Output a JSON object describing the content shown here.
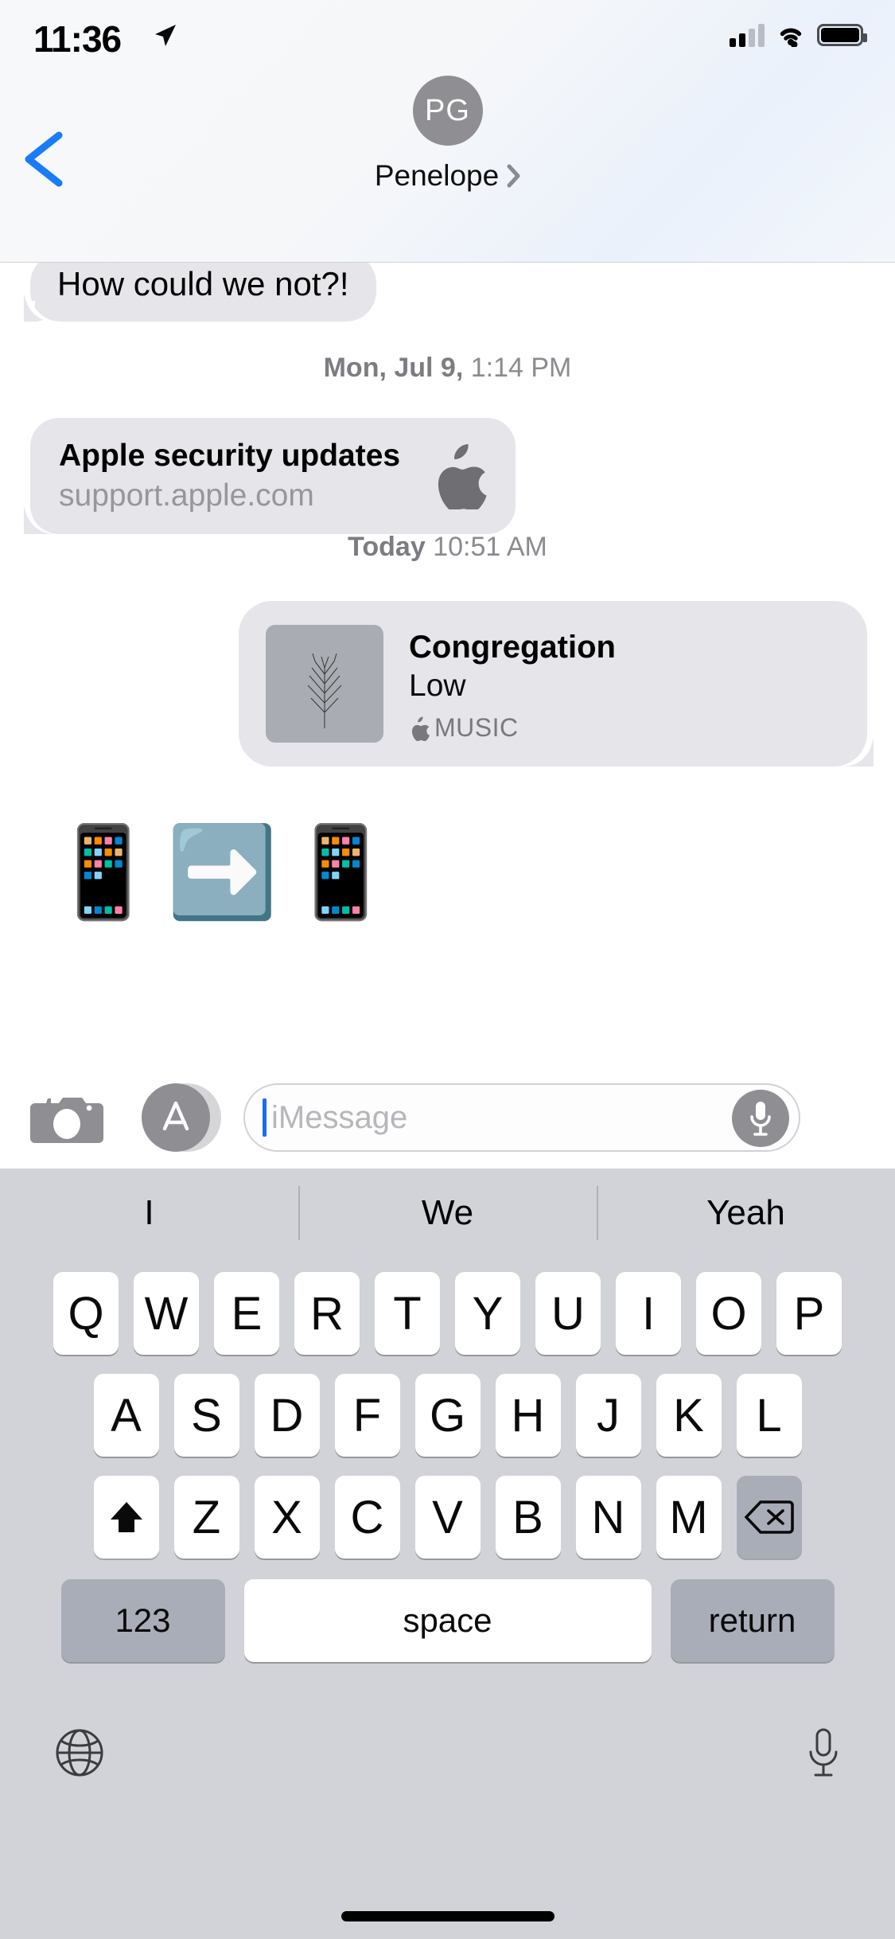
{
  "status_bar": {
    "time": "11:36",
    "location_icon": "location-arrow-icon",
    "cellular_icon": "cellular-bars-icon",
    "wifi_icon": "wifi-icon",
    "battery_icon": "battery-full-icon"
  },
  "header": {
    "back_icon": "chevron-left-icon",
    "avatar_initials": "PG",
    "contact_name": "Penelope",
    "detail_chevron_icon": "chevron-right-icon"
  },
  "conversation": [
    {
      "kind": "text",
      "side": "incoming",
      "text": "How could we not?!"
    },
    {
      "kind": "timestamp",
      "day": "Mon, Jul 9,",
      "time": "1:14 PM"
    },
    {
      "kind": "link-preview",
      "side": "incoming",
      "title": "Apple security updates",
      "domain": "support.apple.com",
      "icon": "apple-logo-icon"
    },
    {
      "kind": "timestamp",
      "day": "Today",
      "time": "10:51 AM"
    },
    {
      "kind": "music-card",
      "side": "outgoing",
      "title": "Congregation",
      "artist": "Low",
      "brand": "MUSIC",
      "brand_icon": "apple-logo-icon",
      "artwork": "bare-tree-album-art"
    },
    {
      "kind": "emoji",
      "side": "incoming",
      "text": "📱➡️📱"
    }
  ],
  "input_toolbar": {
    "camera_icon": "camera-icon",
    "appstore_icon": "app-store-icon",
    "message_placeholder": "iMessage",
    "message_value": "",
    "mic_icon": "microphone-icon"
  },
  "keyboard": {
    "predictions": [
      "I",
      "We",
      "Yeah"
    ],
    "row1": [
      "Q",
      "W",
      "E",
      "R",
      "T",
      "Y",
      "U",
      "I",
      "O",
      "P"
    ],
    "row2": [
      "A",
      "S",
      "D",
      "F",
      "G",
      "H",
      "J",
      "K",
      "L"
    ],
    "row3_letters": [
      "Z",
      "X",
      "C",
      "V",
      "B",
      "N",
      "M"
    ],
    "shift_icon": "shift-up-arrow-icon",
    "delete_icon": "backspace-delete-icon",
    "numeric_label": "123",
    "space_label": "space",
    "return_label": "return",
    "globe_icon": "globe-language-icon",
    "dictation_icon": "microphone-icon"
  },
  "colors": {
    "incoming_bubble": "#e6e5ea",
    "accent_blue": "#1a6cf2",
    "keyboard_background": "#d1d3d9",
    "special_key": "#a9adb8",
    "secondary_text": "#8b8b90"
  }
}
